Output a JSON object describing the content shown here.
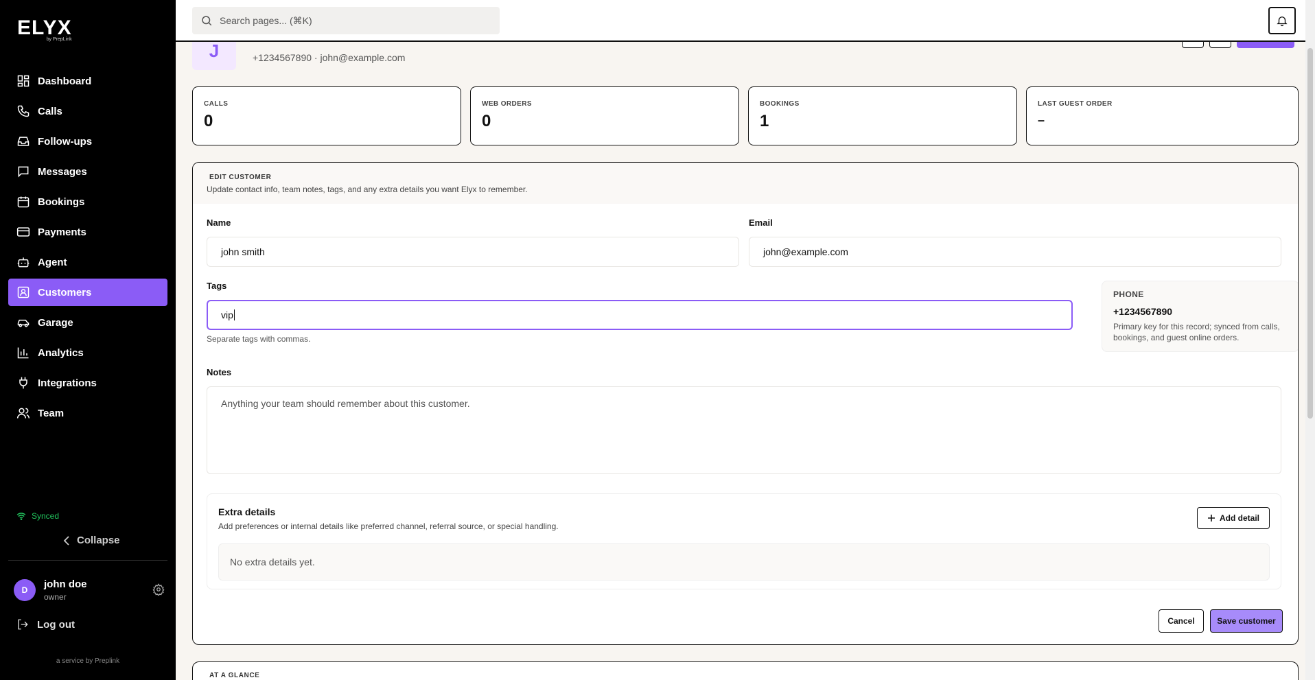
{
  "brand": {
    "name": "ELYX",
    "byline": "by PrepLink"
  },
  "search": {
    "placeholder": "Search pages... (⌘K)"
  },
  "sidebar": {
    "items": [
      {
        "label": "Dashboard",
        "icon": "dashboard-icon"
      },
      {
        "label": "Calls",
        "icon": "phone-icon"
      },
      {
        "label": "Follow-ups",
        "icon": "inbox-icon"
      },
      {
        "label": "Messages",
        "icon": "message-icon"
      },
      {
        "label": "Bookings",
        "icon": "calendar-icon"
      },
      {
        "label": "Payments",
        "icon": "credit-card-icon"
      },
      {
        "label": "Agent",
        "icon": "bot-icon"
      },
      {
        "label": "Customers",
        "icon": "contact-icon",
        "active": true
      },
      {
        "label": "Garage",
        "icon": "car-icon"
      },
      {
        "label": "Analytics",
        "icon": "chart-icon"
      },
      {
        "label": "Integrations",
        "icon": "plug-icon"
      },
      {
        "label": "Team",
        "icon": "users-icon"
      }
    ],
    "synced_label": "Synced",
    "collapse_label": "Collapse",
    "user": {
      "initial": "D",
      "name": "john doe",
      "role": "owner"
    },
    "logout_label": "Log out",
    "service_label": "a service by Preplink"
  },
  "profile": {
    "initial": "J",
    "subtitle": "+1234567890 · john@example.com"
  },
  "stats": [
    {
      "label": "CALLS",
      "value": "0"
    },
    {
      "label": "WEB ORDERS",
      "value": "0"
    },
    {
      "label": "BOOKINGS",
      "value": "1"
    },
    {
      "label": "LAST GUEST ORDER",
      "value": "–"
    }
  ],
  "edit": {
    "title": "EDIT CUSTOMER",
    "description": "Update contact info, team notes, tags, and any extra details you want Elyx to remember.",
    "name_label": "Name",
    "name_value": "john smith",
    "email_label": "Email",
    "email_value": "john@example.com",
    "tags_label": "Tags",
    "tags_value": "vip",
    "tags_hint": "Separate tags with commas.",
    "phone": {
      "label": "PHONE",
      "value": "+1234567890",
      "description": "Primary key for this record; synced from calls, bookings, and guest online orders."
    },
    "notes_label": "Notes",
    "notes_placeholder": "Anything your team should remember about this customer.",
    "extra": {
      "title": "Extra details",
      "description": "Add preferences or internal details like preferred channel, referral source, or special handling.",
      "add_label": "Add detail",
      "empty_label": "No extra details yet."
    },
    "cancel_label": "Cancel",
    "save_label": "Save customer"
  },
  "glance": {
    "title": "AT A GLANCE"
  },
  "colors": {
    "accent": "#8b5cf6",
    "sidebar_bg": "#000000",
    "page_bg": "#f8f5f1",
    "synced": "#22c55e"
  }
}
